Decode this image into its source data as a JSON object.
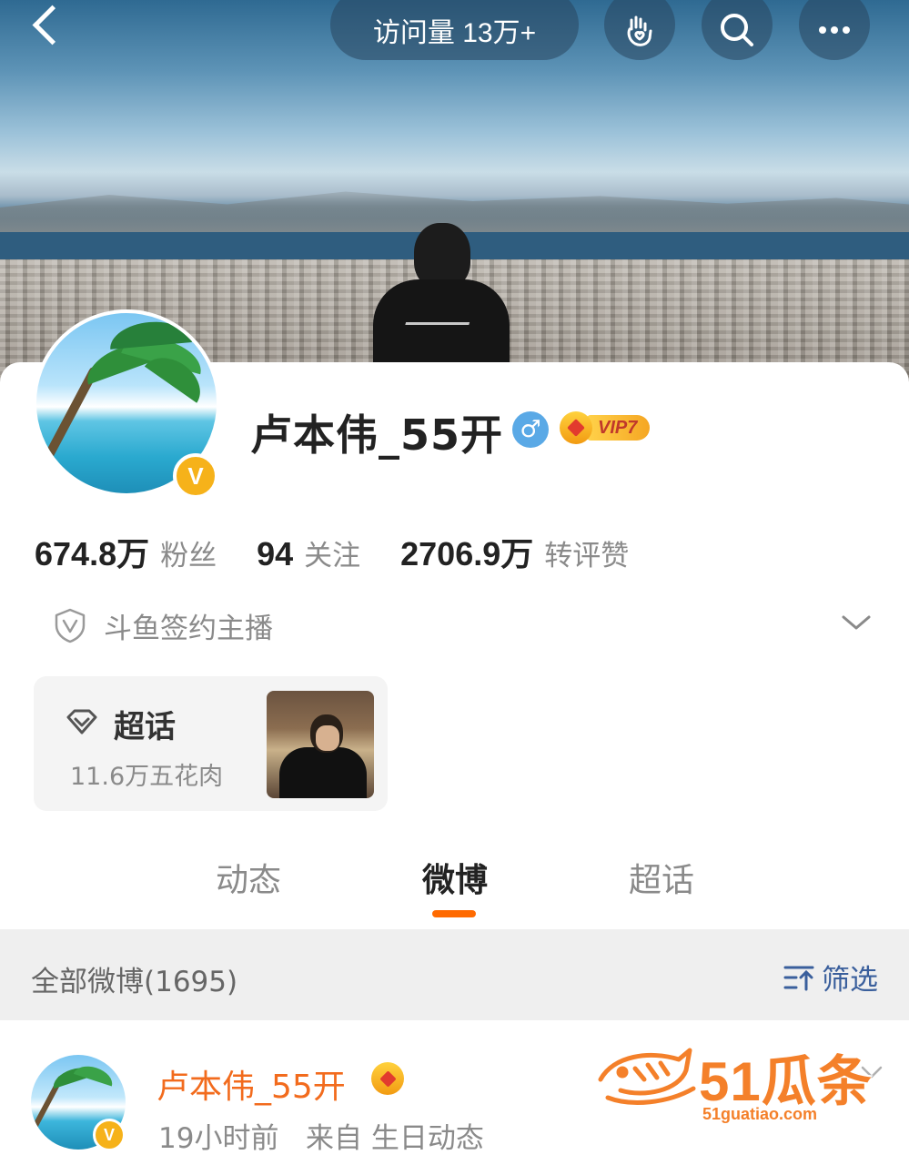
{
  "header": {
    "visits_label": "访问量 13万+",
    "buttons": [
      "back-icon",
      "hand-heart-icon",
      "search-icon",
      "more-icon"
    ]
  },
  "profile": {
    "name": "卢本伟_55开",
    "gender_symbol": "♂",
    "vip_label": "VIP7",
    "verified_symbol": "V",
    "stats": [
      {
        "num": "674.8万",
        "label": "粉丝"
      },
      {
        "num": "94",
        "label": "关注"
      },
      {
        "num": "2706.9万",
        "label": "转评赞"
      }
    ],
    "auth_text": "斗鱼签约主播"
  },
  "chaohua": {
    "title": "超话",
    "subtitle": "11.6万五花肉"
  },
  "tabs": [
    {
      "label": "动态",
      "active": false
    },
    {
      "label": "微博",
      "active": true
    },
    {
      "label": "超话",
      "active": false
    }
  ],
  "filter": {
    "count_label": "全部微博(1695)",
    "button_label": "筛选"
  },
  "post": {
    "name": "卢本伟_55开",
    "verified_symbol": "V",
    "time": "19小时前",
    "source": "来自 生日动态"
  },
  "watermark": {
    "text": "51瓜条",
    "url": "51guatiao.com"
  },
  "colors": {
    "accent": "#ff6a00",
    "vip_gold": "#f6b21a",
    "link_blue": "#3a5f9c",
    "name_orange": "#f26b1d"
  }
}
